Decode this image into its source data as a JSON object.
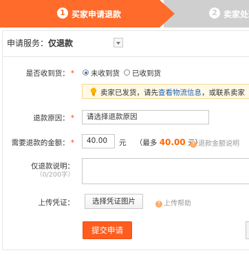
{
  "steps": [
    {
      "num": "1",
      "label": "买家申请退款",
      "active": true
    },
    {
      "num": "2",
      "label": "卖家处理",
      "active": false
    }
  ],
  "service": {
    "label": "申请服务：",
    "value": "仅退款"
  },
  "received": {
    "label": "是否收到货：",
    "required_mark": "*",
    "options": [
      {
        "label": "未收到货",
        "checked": true
      },
      {
        "label": "已收到货",
        "checked": false
      }
    ]
  },
  "notice": {
    "prefix": "卖家已发货，请先",
    "link": "查看物流信息",
    "suffix": "，或联系卖家"
  },
  "reason": {
    "label": "退款原因：",
    "required_mark": "*",
    "placeholder": "请选择退款原因"
  },
  "amount": {
    "label": "需要退款的金额：",
    "required_mark": "*",
    "value": "40.00",
    "unit": "元",
    "max_prefix": "（最多",
    "max_value": "40.00",
    "max_suffix": "元）",
    "help": "退款金额说明"
  },
  "description": {
    "label": "仅退款说明：",
    "counter": "（0/200字）"
  },
  "upload": {
    "label": "上传凭证：",
    "button": "选择凭证图片",
    "help": "上传帮助"
  },
  "submit": {
    "label": "提交申请"
  },
  "colors": {
    "accent": "#ff6b2a",
    "link": "#1d5fb8",
    "price": "#ff6600"
  }
}
